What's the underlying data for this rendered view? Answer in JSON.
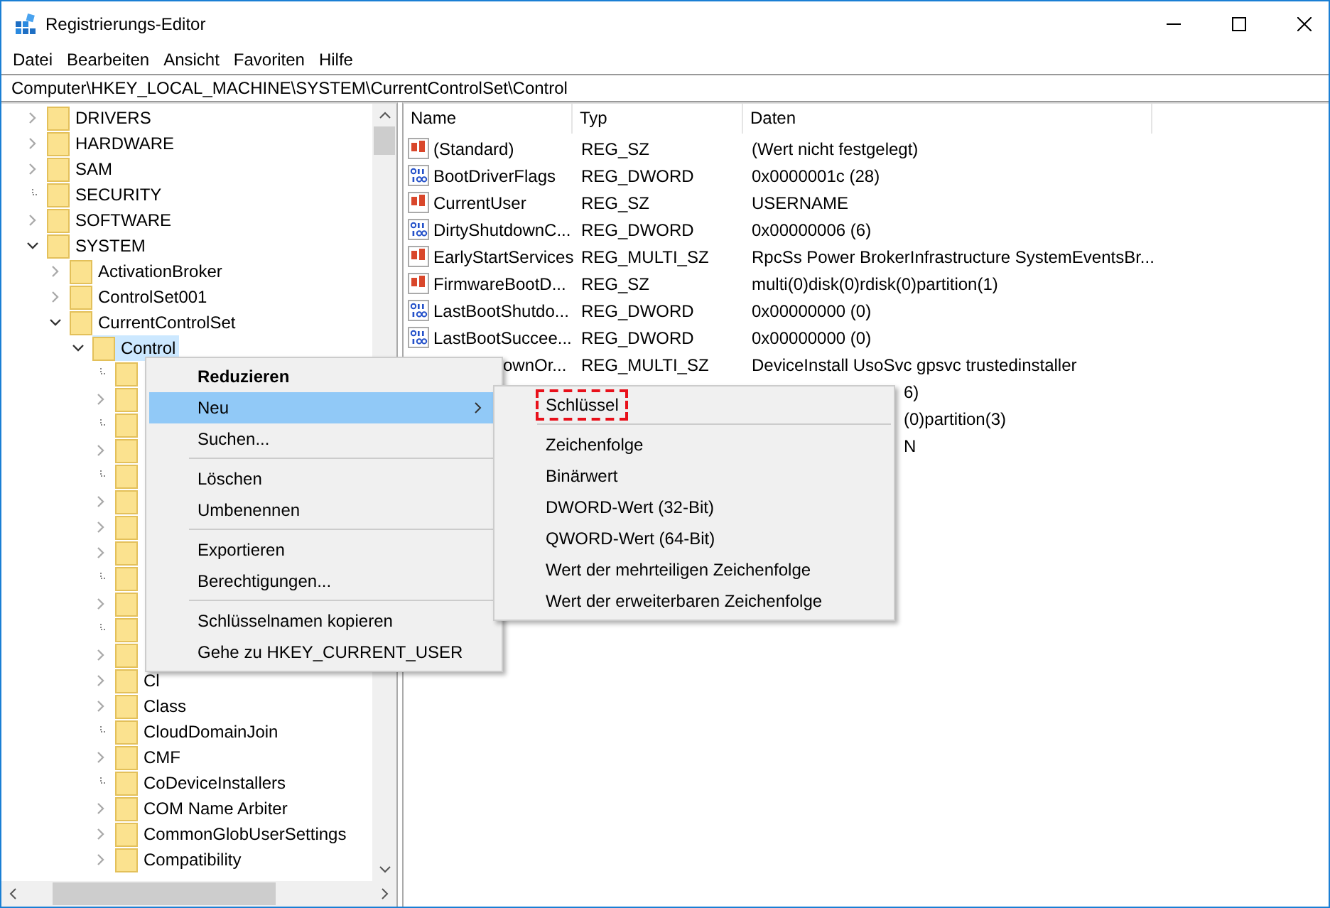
{
  "window": {
    "title": "Registrierungs-Editor"
  },
  "menu_bar": [
    "Datei",
    "Bearbeiten",
    "Ansicht",
    "Favoriten",
    "Hilfe"
  ],
  "address": "Computer\\HKEY_LOCAL_MACHINE\\SYSTEM\\CurrentControlSet\\Control",
  "tree": [
    {
      "label": "DRIVERS",
      "expandable": true,
      "expanded": false,
      "selected": false
    },
    {
      "label": "HARDWARE",
      "expandable": true,
      "expanded": false,
      "selected": false
    },
    {
      "label": "SAM",
      "expandable": true,
      "expanded": false,
      "selected": false
    },
    {
      "label": "SECURITY",
      "expandable": false,
      "selected": false
    },
    {
      "label": "SOFTWARE",
      "expandable": true,
      "expanded": false,
      "selected": false
    },
    {
      "label": "SYSTEM",
      "expandable": true,
      "expanded": true,
      "selected": false,
      "children": [
        {
          "label": "ActivationBroker",
          "expandable": true,
          "expanded": false,
          "selected": false
        },
        {
          "label": "ControlSet001",
          "expandable": true,
          "expanded": false,
          "selected": false
        },
        {
          "label": "CurrentControlSet",
          "expandable": true,
          "expanded": true,
          "selected": false,
          "children": [
            {
              "label": "Control",
              "expandable": true,
              "expanded": true,
              "selected": true,
              "children": [
                {
                  "expandable": false,
                  "selected": false
                },
                {
                  "expandable": true,
                  "expanded": false,
                  "selected": false
                },
                {
                  "expandable": false,
                  "selected": false
                },
                {
                  "expandable": true,
                  "expanded": false,
                  "selected": false
                },
                {
                  "expandable": false,
                  "selected": false
                },
                {
                  "expandable": true,
                  "expanded": false,
                  "selected": false
                },
                {
                  "expandable": true,
                  "expanded": false,
                  "selected": false
                },
                {
                  "expandable": true,
                  "expanded": false,
                  "selected": false
                },
                {
                  "expandable": false,
                  "selected": false
                },
                {
                  "expandable": true,
                  "expanded": false,
                  "selected": false
                },
                {
                  "expandable": false,
                  "selected": false
                },
                {
                  "expandable": true,
                  "expanded": false,
                  "selected": false
                },
                {
                  "label": "Cl",
                  "expandable": true,
                  "expanded": false,
                  "selected": false
                },
                {
                  "label": "Class",
                  "expandable": true,
                  "expanded": false,
                  "selected": false
                },
                {
                  "label": "CloudDomainJoin",
                  "expandable": false,
                  "selected": false
                },
                {
                  "label": "CMF",
                  "expandable": true,
                  "expanded": false,
                  "selected": false
                },
                {
                  "label": "CoDeviceInstallers",
                  "expandable": false,
                  "selected": false
                },
                {
                  "label": "COM Name Arbiter",
                  "expandable": true,
                  "expanded": false,
                  "selected": false
                },
                {
                  "label": "CommonGlobUserSettings",
                  "expandable": true,
                  "expanded": false,
                  "selected": false
                },
                {
                  "label": "Compatibility",
                  "expandable": true,
                  "expanded": false,
                  "selected": false
                }
              ]
            }
          ]
        }
      ]
    }
  ],
  "table": {
    "columns": [
      "Name",
      "Typ",
      "Daten"
    ],
    "rows": [
      {
        "kind": "string",
        "name": "(Standard)",
        "type": "REG_SZ",
        "data": "(Wert nicht festgelegt)"
      },
      {
        "kind": "binary",
        "name": "BootDriverFlags",
        "type": "REG_DWORD",
        "data": "0x0000001c (28)"
      },
      {
        "kind": "string",
        "name": "CurrentUser",
        "type": "REG_SZ",
        "data": "USERNAME"
      },
      {
        "kind": "binary",
        "name": "DirtyShutdownC...",
        "type": "REG_DWORD",
        "data": "0x00000006 (6)"
      },
      {
        "kind": "string",
        "name": "EarlyStartServices",
        "type": "REG_MULTI_SZ",
        "data": "RpcSs Power BrokerInfrastructure SystemEventsBr..."
      },
      {
        "kind": "string",
        "name": "FirmwareBootD...",
        "type": "REG_SZ",
        "data": "multi(0)disk(0)rdisk(0)partition(1)"
      },
      {
        "kind": "binary",
        "name": "LastBootShutdo...",
        "type": "REG_DWORD",
        "data": "0x00000000 (0)"
      },
      {
        "kind": "binary",
        "name": "LastBootSuccee...",
        "type": "REG_DWORD",
        "data": "0x00000000 (0)"
      },
      {
        "kind": "partial",
        "name": "ownOr...",
        "type": "REG_MULTI_SZ",
        "data": "DeviceInstall UsoSvc gpsvc trustedinstaller"
      },
      {
        "kind": "fragment",
        "data": "6)"
      },
      {
        "kind": "fragment",
        "data": "(0)partition(3)"
      },
      {
        "kind": "fragment",
        "data": "N"
      }
    ]
  },
  "context_menu": [
    {
      "kind": "item",
      "label": "Reduzieren",
      "default": true,
      "selected": false,
      "submenu": false
    },
    {
      "kind": "item",
      "label": "Neu",
      "default": false,
      "selected": true,
      "submenu": true
    },
    {
      "kind": "item",
      "label": "Suchen...",
      "default": false,
      "selected": false,
      "submenu": false
    },
    {
      "kind": "separator"
    },
    {
      "kind": "item",
      "label": "Löschen",
      "default": false,
      "selected": false,
      "submenu": false
    },
    {
      "kind": "item",
      "label": "Umbenennen",
      "default": false,
      "selected": false,
      "submenu": false
    },
    {
      "kind": "separator"
    },
    {
      "kind": "item",
      "label": "Exportieren",
      "default": false,
      "selected": false,
      "submenu": false
    },
    {
      "kind": "item",
      "label": "Berechtigungen...",
      "default": false,
      "selected": false,
      "submenu": false
    },
    {
      "kind": "separator"
    },
    {
      "kind": "item",
      "label": "Schlüsselnamen kopieren",
      "default": false,
      "selected": false,
      "submenu": false
    },
    {
      "kind": "item",
      "label": "Gehe zu HKEY_CURRENT_USER",
      "default": false,
      "selected": false,
      "submenu": false
    }
  ],
  "submenu": [
    {
      "kind": "item",
      "label": "Schlüssel",
      "marked": true
    },
    {
      "kind": "separator"
    },
    {
      "kind": "item",
      "label": "Zeichenfolge",
      "marked": false
    },
    {
      "kind": "item",
      "label": "Binärwert",
      "marked": false
    },
    {
      "kind": "item",
      "label": "DWORD-Wert (32-Bit)",
      "marked": false
    },
    {
      "kind": "item",
      "label": "QWORD-Wert (64-Bit)",
      "marked": false
    },
    {
      "kind": "item",
      "label": "Wert der mehrteiligen Zeichenfolge",
      "marked": false
    },
    {
      "kind": "item",
      "label": "Wert der erweiterbaren Zeichenfolge",
      "marked": false
    }
  ]
}
